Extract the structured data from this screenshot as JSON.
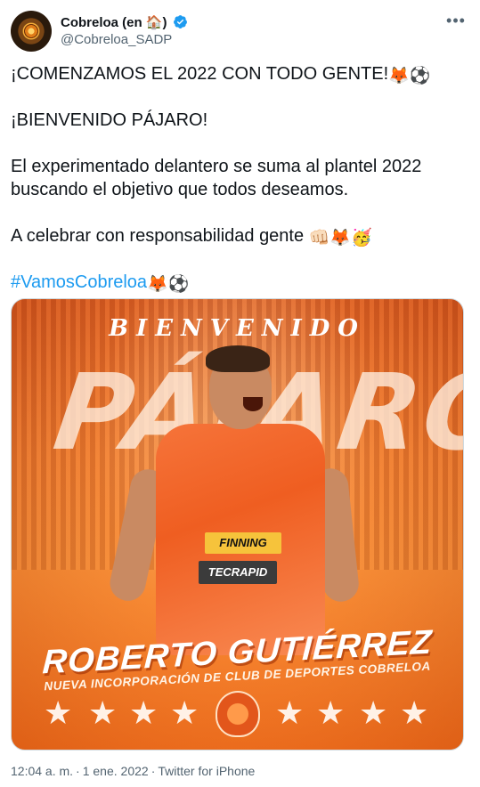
{
  "author": {
    "display_name": "Cobreloa (en 🏠)",
    "handle": "@Cobreloa_SADP"
  },
  "tweet": {
    "line1": "¡COMENZAMOS EL 2022 CON TODO GENTE!",
    "line1_emoji": "🦊⚽",
    "line2": "¡BIENVENIDO PÁJARO!",
    "line3": "El experimentado delantero se suma al plantel 2022 buscando el objetivo que todos deseamos.",
    "line4": "A celebrar con responsabilidad gente",
    "line4_emoji": "👊🏻🦊🥳",
    "hashtag": "#VamosCobreloa",
    "hashtag_emoji": "🦊⚽"
  },
  "media": {
    "top_caption": "BIENVENIDO",
    "big_name": "PÁJARO",
    "sponsor1": "FINNING",
    "sponsor2": "TECRAPID",
    "player_name": "ROBERTO GUTIÉRREZ",
    "subtitle": "NUEVA INCORPORACIÓN DE CLUB DE DEPORTES COBRELOA",
    "star_glyph": "★"
  },
  "meta": {
    "time": "12:04 a. m.",
    "date": "1 ene. 2022",
    "source": "Twitter for iPhone",
    "separator": "·"
  },
  "colors": {
    "link": "#1d9bf0",
    "secondary_text": "#536471",
    "primary_text": "#0f1419"
  }
}
